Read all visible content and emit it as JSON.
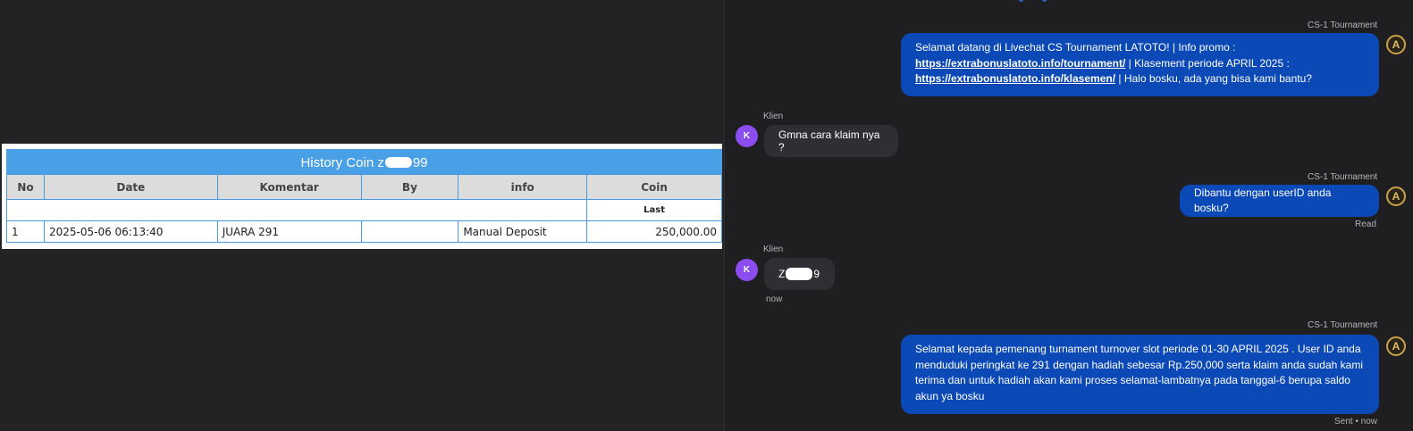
{
  "history": {
    "title_prefix": "History Coin z",
    "title_suffix": "99",
    "headers": [
      "No",
      "Date",
      "Komentar",
      "By",
      "info",
      "Coin"
    ],
    "last_label": "Last",
    "rows": [
      {
        "no": "1",
        "date": "2025-05-06 06:13:40",
        "komentar": "JUARA 291",
        "by": "",
        "info": "Manual Deposit",
        "coin": "250,000.00"
      }
    ]
  },
  "chat": {
    "messages": [
      {
        "sender": "CS-1 Tournament",
        "part1": "Selamat datang di Livechat CS Tournament LATOTO! | Info promo :",
        "link1": "https://extrabonuslatoto.info/tournament/",
        "part2": " | Klasement periode APRIL 2025 :",
        "link2": "https://extrabonuslatoto.info/klasemen/",
        "part3": " | Halo bosku, ada yang bisa kami bantu?"
      },
      {
        "sender": "Klien",
        "text": "Gmna cara klaim nya ?"
      },
      {
        "sender": "CS-1 Tournament",
        "text": "Dibantu dengan userID anda bosku?",
        "status": "Read"
      },
      {
        "sender": "Klien",
        "text_prefix": "Z",
        "text_suffix": "9",
        "time": "now"
      },
      {
        "sender": "CS-1 Tournament",
        "text": "Selamat kepada pemenang turnament turnover slot periode 01-30 APRIL 2025 . User ID anda menduduki peringkat ke 291 dengan hadiah sebesar Rp.250,000 serta klaim anda sudah kami terima dan untuk hadiah akan kami proses selamat-lambatnya pada tanggal-6 berupa saldo akun ya bosku",
        "status": "Sent • now"
      }
    ],
    "avatar_client": "K",
    "avatar_agent": "A"
  },
  "colors": {
    "bubble_out": "#0b49b6",
    "bubble_in": "#2f2f33",
    "avatar_client": "#8b4cf0",
    "table_header": "#4aa0e6",
    "coin_green": "#1f8f1f"
  }
}
